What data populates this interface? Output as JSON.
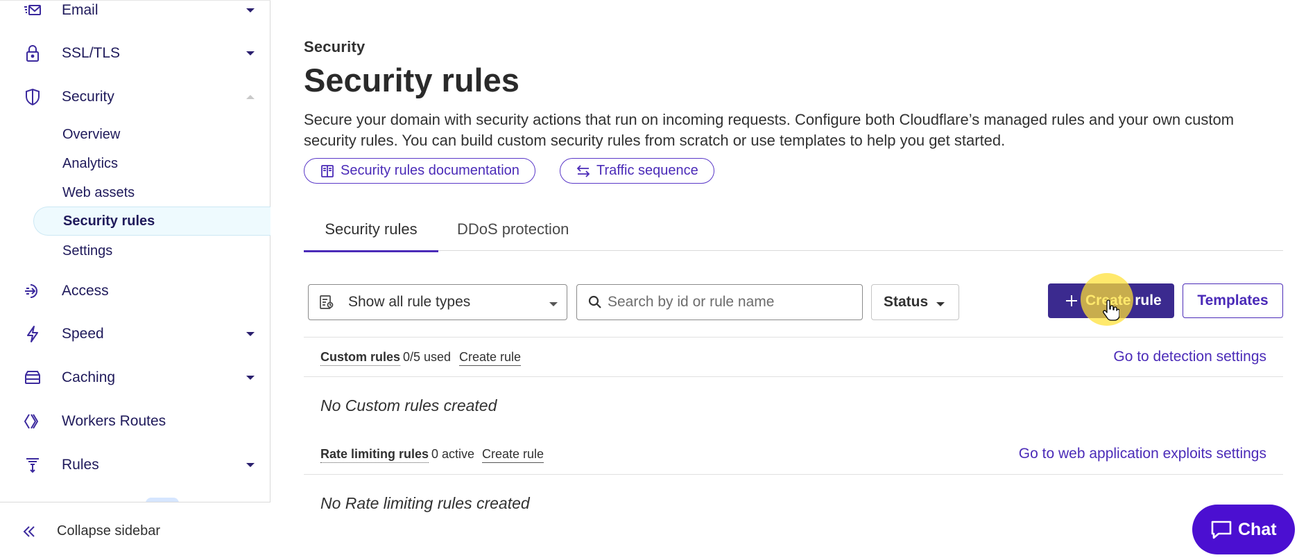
{
  "sidebar": {
    "items": [
      {
        "label": "Email",
        "icon": "email-icon"
      },
      {
        "label": "SSL/TLS",
        "icon": "lock-icon"
      },
      {
        "label": "Security",
        "icon": "shield-icon"
      },
      {
        "label": "Access",
        "icon": "access-icon"
      },
      {
        "label": "Speed",
        "icon": "lightning-icon"
      },
      {
        "label": "Caching",
        "icon": "server-icon"
      },
      {
        "label": "Workers Routes",
        "icon": "workers-icon"
      },
      {
        "label": "Rules",
        "icon": "filter-icon"
      }
    ],
    "security_sub": [
      {
        "label": "Overview"
      },
      {
        "label": "Analytics"
      },
      {
        "label": "Web assets"
      },
      {
        "label": "Security rules"
      },
      {
        "label": "Settings"
      }
    ],
    "collapse_label": "Collapse sidebar"
  },
  "main": {
    "breadcrumb": "Security",
    "title": "Security rules",
    "description": "Secure your domain with security actions that run on incoming requests. Configure both Cloudflare’s managed rules and your own custom security rules. You can build custom security rules from scratch or use templates to help you get started.",
    "doc_link": "Security rules documentation",
    "traffic_link": "Traffic sequence",
    "tabs": [
      {
        "label": "Security rules"
      },
      {
        "label": "DDoS protection"
      }
    ],
    "toolbar": {
      "rule_type_selected": "Show all rule types",
      "search_placeholder": "Search by id or rule name",
      "status_label": "Status",
      "create_label": "Create rule",
      "templates_label": "Templates"
    },
    "sections": [
      {
        "title": "Custom rules",
        "count": "0/5 used",
        "create": "Create rule",
        "link": "Go to detection settings",
        "empty": "No Custom rules created"
      },
      {
        "title": "Rate limiting rules",
        "count": "0 active",
        "create": "Create rule",
        "link": "Go to web application exploits settings",
        "empty": "No Rate limiting rules created"
      }
    ]
  },
  "chat_label": "Chat",
  "colors": {
    "accent": "#4b2bb8",
    "primary_button": "#3b2a8f",
    "chat": "#4b0fd1",
    "nav_text": "#1f1a5b"
  }
}
